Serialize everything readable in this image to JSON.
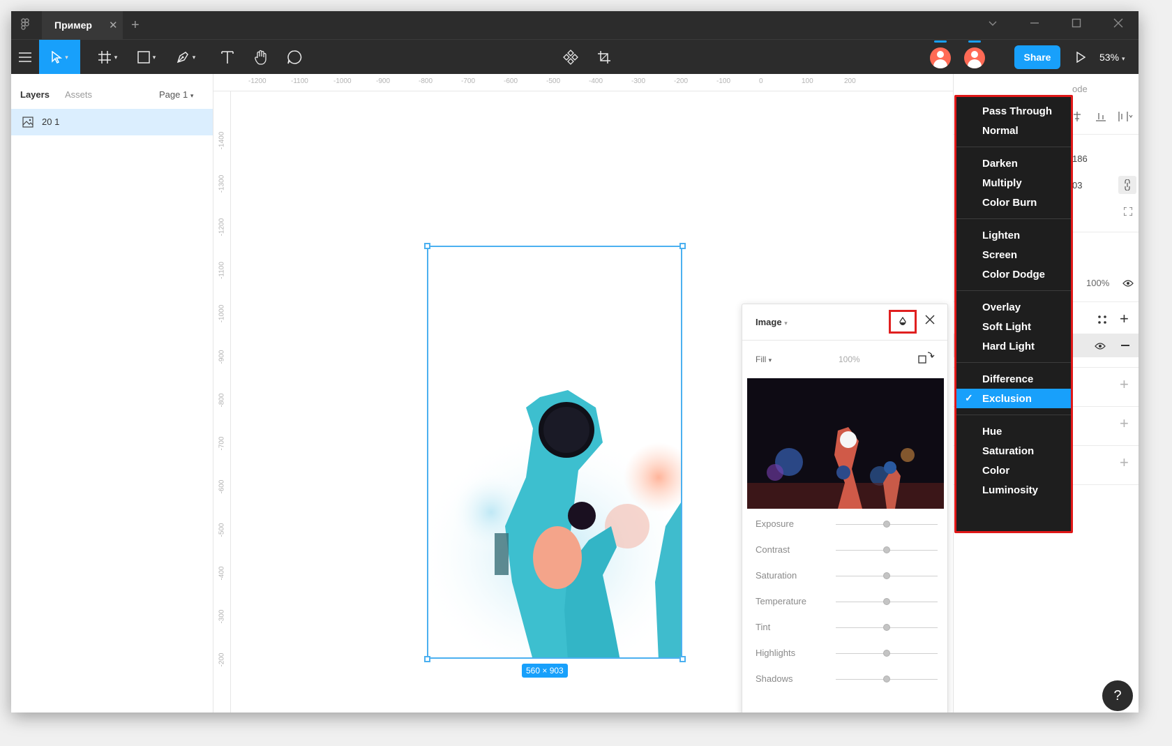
{
  "titlebar": {
    "tab_title": "Пример",
    "tab_close": "✕",
    "new_tab": "+"
  },
  "toolbar": {
    "tools": [
      "menu-icon",
      "move-icon",
      "frame-icon",
      "rectangle-icon",
      "pen-icon",
      "text-icon",
      "hand-icon",
      "comment-icon",
      "component-icon",
      "crop-icon"
    ],
    "share_label": "Share",
    "zoom_label": "53%"
  },
  "left_panel": {
    "tab_layers": "Layers",
    "tab_assets": "Assets",
    "page_label": "Page 1",
    "layers": [
      {
        "name": "20 1",
        "icon": "image-icon"
      }
    ]
  },
  "canvas": {
    "ruler_top": [
      "-1200",
      "-1100",
      "-1000",
      "-900",
      "-800",
      "-700",
      "-600",
      "-500",
      "-400",
      "-300",
      "-200",
      "-100",
      "0",
      "100",
      "200"
    ],
    "ruler_left": [
      "-1400",
      "-1300",
      "-1200",
      "-1100",
      "-1000",
      "-900",
      "-800",
      "-700",
      "-600",
      "-500",
      "-400",
      "-300",
      "-200"
    ],
    "selection_size": "560 × 903"
  },
  "image_popup": {
    "title": "Image",
    "fill_mode": "Fill",
    "opacity": "100%",
    "adjustments": [
      {
        "label": "Exposure",
        "value": 0.5
      },
      {
        "label": "Contrast",
        "value": 0.5
      },
      {
        "label": "Saturation",
        "value": 0.5
      },
      {
        "label": "Temperature",
        "value": 0.5
      },
      {
        "label": "Tint",
        "value": 0.5
      },
      {
        "label": "Highlights",
        "value": 0.5
      },
      {
        "label": "Shadows",
        "value": 0.5
      }
    ]
  },
  "right_panel": {
    "partial_mode": "ode",
    "partial_y": "186",
    "partial_h": "03",
    "layer_opacity": "100%"
  },
  "blend_menu": {
    "groups": [
      [
        "Pass Through",
        "Normal"
      ],
      [
        "Darken",
        "Multiply",
        "Color Burn"
      ],
      [
        "Lighten",
        "Screen",
        "Color Dodge"
      ],
      [
        "Overlay",
        "Soft Light",
        "Hard Light"
      ],
      [
        "Difference",
        "Exclusion"
      ],
      [
        "Hue",
        "Saturation",
        "Color",
        "Luminosity"
      ]
    ],
    "selected": "Exclusion",
    "check": "✓"
  },
  "help_label": "?",
  "colors": {
    "accent": "#18a0fb",
    "toolbar": "#2c2c2c",
    "highlight_border": "#e01818"
  }
}
